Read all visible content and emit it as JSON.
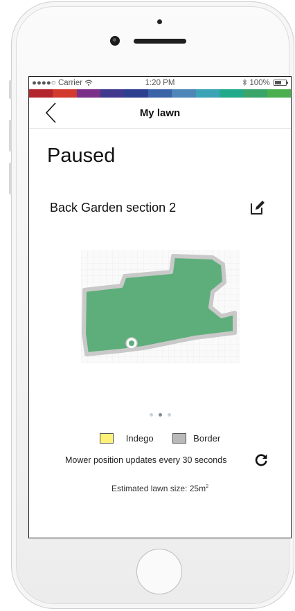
{
  "status_bar": {
    "signal_icon": "signal-dots-icon",
    "carrier": "Carrier",
    "wifi_icon": "wifi-icon",
    "time": "1:20 PM",
    "bluetooth_icon": "bluetooth-icon",
    "battery": "100%",
    "battery_icon": "battery-icon"
  },
  "color_bar": [
    "#b3262e",
    "#d23a2f",
    "#7a2f88",
    "#3f3a8e",
    "#2d3f8f",
    "#3a63a8",
    "#4f86b9",
    "#3aa3b5",
    "#21a98c",
    "#3aa56a",
    "#4caf4f"
  ],
  "nav": {
    "back_icon": "chevron-left-icon",
    "title": "My lawn"
  },
  "mower_status": "Paused",
  "lawn": {
    "name": "Back Garden section 2",
    "edit_icon": "edit-icon"
  },
  "map": {
    "lawn_color": "#5dae7a",
    "border_color": "#c9c9c9",
    "marker_icon": "mower-position-icon"
  },
  "pager": {
    "count": 3,
    "active": 2
  },
  "legend": [
    {
      "label": "Indego",
      "color": "#fef278"
    },
    {
      "label": "Border",
      "color": "#b9b9b9"
    }
  ],
  "info": {
    "update_text": "Mower position updates every 30 seconds",
    "refresh_icon": "refresh-icon",
    "size_label": "Estimated lawn size: 25m",
    "size_unit_sup": "2"
  },
  "hardware": {
    "home_button_icon": "home-button-icon"
  }
}
